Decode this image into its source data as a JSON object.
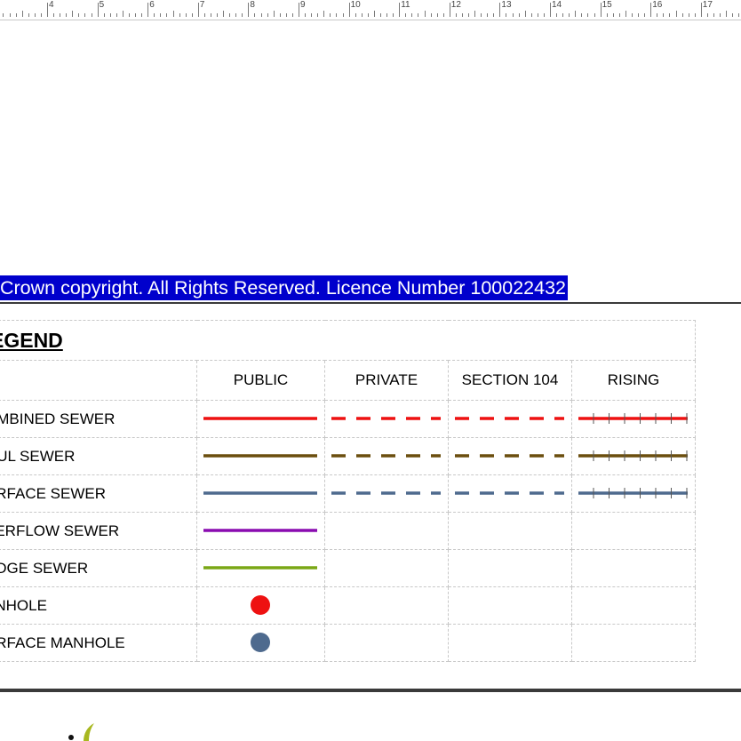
{
  "ruler": {
    "labels": [
      "4",
      "5",
      "6",
      "7",
      "8",
      "9",
      "10",
      "11",
      "12",
      "13",
      "14",
      "15",
      "16",
      "17"
    ]
  },
  "copyright": {
    "text": "Crown copyright. All Rights Reserved. Licence Number 100022432",
    "highlight_color": "#0000cc"
  },
  "legend": {
    "title": "EGEND",
    "columns": [
      "PUBLIC",
      "PRIVATE",
      "SECTION 104",
      "RISING"
    ],
    "rows": [
      {
        "label": "OMBINED SEWER",
        "color": "#ee1111",
        "symbol": "line",
        "public": true,
        "private": "dashed",
        "section104": "dashed",
        "rising": "ticked"
      },
      {
        "label": "OUL SEWER",
        "color": "#6b4e0e",
        "symbol": "line",
        "public": true,
        "private": "dashed",
        "section104": "dashed",
        "rising": "ticked"
      },
      {
        "label": "URFACE SEWER",
        "color": "#4e6a8e",
        "symbol": "line",
        "public": true,
        "private": "dashed",
        "section104": "dashed",
        "rising": "ticked"
      },
      {
        "label": "VERFLOW SEWER",
        "color": "#8a0cb0",
        "symbol": "line",
        "public": true,
        "private": "none",
        "section104": "none",
        "rising": "none"
      },
      {
        "label": "UDGE SEWER",
        "color": "#7aa716",
        "symbol": "line",
        "public": true,
        "private": "none",
        "section104": "none",
        "rising": "none"
      },
      {
        "label": "ANHOLE",
        "color": "#ee1111",
        "symbol": "dot",
        "public": true,
        "private": "none",
        "section104": "none",
        "rising": "none"
      },
      {
        "label": "URFACE MANHOLE",
        "color": "#4e6a8e",
        "symbol": "dot",
        "public": true,
        "private": "none",
        "section104": "none",
        "rising": "none"
      }
    ]
  },
  "colors": {
    "rule": "#3a3a3a",
    "grid": "#c8c8c8",
    "logo_accent": "#a8b820"
  }
}
